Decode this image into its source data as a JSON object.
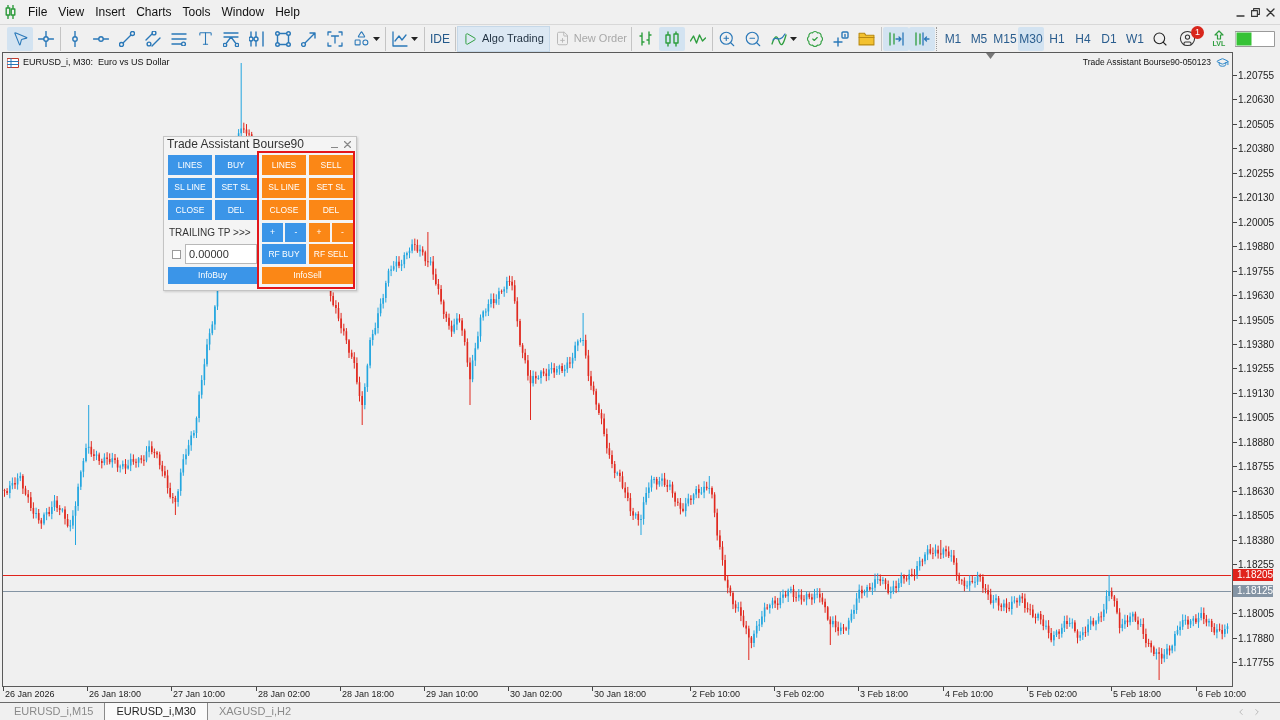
{
  "menu_bar": {
    "items": [
      "File",
      "View",
      "Insert",
      "Charts",
      "Tools",
      "Window",
      "Help"
    ]
  },
  "toolbar": {
    "tool_groups": [
      [
        {
          "kind": "cursor",
          "selected": true
        },
        {
          "kind": "crosshair",
          "selected": false
        }
      ],
      [
        {
          "kind": "vertical-line",
          "selected": false
        },
        {
          "kind": "horizontal-line",
          "selected": false
        },
        {
          "kind": "trend-line",
          "selected": false
        },
        {
          "kind": "channel",
          "selected": false
        },
        {
          "kind": "levels",
          "selected": false
        },
        {
          "kind": "text",
          "selected": false
        },
        {
          "kind": "fan",
          "selected": false
        },
        {
          "kind": "cycle-lines",
          "selected": false
        },
        {
          "kind": "rectangle",
          "selected": false
        },
        {
          "kind": "arrow-line",
          "selected": false
        },
        {
          "kind": "text-label",
          "selected": false
        },
        {
          "kind": "shapes",
          "selected": false
        }
      ],
      [
        {
          "kind": "indicator-menu",
          "selected": false
        }
      ]
    ],
    "ide": {
      "label": "IDE"
    },
    "algo_trading": {
      "label": "Algo Trading",
      "on": true
    },
    "new_order": {
      "label": "New Order",
      "disabled": true
    },
    "chart_types": [
      {
        "kind": "bars",
        "selected": false
      },
      {
        "kind": "candles",
        "selected": true
      },
      {
        "kind": "line",
        "selected": false
      }
    ],
    "chart_tools": [
      {
        "kind": "zoom-in"
      },
      {
        "kind": "zoom-out"
      },
      {
        "kind": "indicators"
      },
      {
        "kind": "experts"
      },
      {
        "kind": "add-object"
      },
      {
        "kind": "templates"
      }
    ],
    "scroll_tools": [
      {
        "kind": "autoscroll",
        "selected": true
      },
      {
        "kind": "chart-shift",
        "selected": true
      }
    ],
    "timeframes": [
      {
        "label": "M1",
        "selected": false
      },
      {
        "label": "M5",
        "selected": false
      },
      {
        "label": "M15",
        "selected": false
      },
      {
        "label": "M30",
        "selected": true
      },
      {
        "label": "H1",
        "selected": false
      },
      {
        "label": "H4",
        "selected": false
      },
      {
        "label": "D1",
        "selected": false
      },
      {
        "label": "W1",
        "selected": false
      }
    ],
    "notifications": {
      "count": "1"
    },
    "level_tool": {
      "label": "LVL"
    }
  },
  "chart": {
    "title": "EURUSD_i, M30:  Euro vs US Dollar",
    "expert": "Trade Assistant Bourse90-050123",
    "price_labels": [
      "1.20755",
      "1.20630",
      "1.20505",
      "1.20380",
      "1.20255",
      "1.20130",
      "1.20005",
      "1.19880",
      "1.19755",
      "1.19630",
      "1.19505",
      "1.19380",
      "1.19255",
      "1.19130",
      "1.19005",
      "1.18880",
      "1.18755",
      "1.18630",
      "1.18505",
      "1.18380",
      "1.18255",
      "1.18005",
      "1.17880",
      "1.17755"
    ],
    "price_tags": [
      {
        "text": "1.18205",
        "color": "#e0231c"
      },
      {
        "text": "1.18125",
        "color": "#8494a4"
      }
    ],
    "time_labels": [
      "26 Jan 2026",
      "26 Jan 18:00",
      "27 Jan 10:00",
      "28 Jan 02:00",
      "28 Jan 18:00",
      "29 Jan 10:00",
      "30 Jan 02:00",
      "30 Jan 18:00",
      "2 Feb 10:00",
      "3 Feb 02:00",
      "3 Feb 18:00",
      "4 Feb 10:00",
      "5 Feb 02:00",
      "5 Feb 18:00",
      "6 Feb 10:00"
    ]
  },
  "trade_panel": {
    "title": "Trade Assistant Bourse90",
    "buy_buttons": [
      "LINES",
      "BUY",
      "SL LINE",
      "SET SL",
      "CLOSE",
      "DEL"
    ],
    "trailing_label": "TRAILING TP >>>",
    "trailing_checkbox": {
      "checked": false
    },
    "trailing_value": "0.00000",
    "info_buy": "InfoBuy",
    "highlighted": true,
    "sell_buttons": [
      "LINES",
      "SELL",
      "SL LINE",
      "SET SL",
      "CLOSE",
      "DEL"
    ],
    "step_buttons": [
      {
        "label": "+",
        "color": "#3b95e8"
      },
      {
        "label": "-",
        "color": "#3b95e8"
      },
      {
        "label": "+",
        "color": "#fb8716"
      },
      {
        "label": "-",
        "color": "#fb8716"
      }
    ],
    "rf_buttons": [
      {
        "label": "RF BUY",
        "color": "#3b95e8"
      },
      {
        "label": "RF SELL",
        "color": "#fb8716"
      }
    ],
    "info_sell": "InfoSell"
  },
  "chart_tabs": [
    {
      "label": "EURUSD_i,M15",
      "selected": false
    },
    {
      "label": "EURUSD_i,M30",
      "selected": true
    },
    {
      "label": "XAGUSD_i,H2",
      "selected": false
    }
  ]
}
